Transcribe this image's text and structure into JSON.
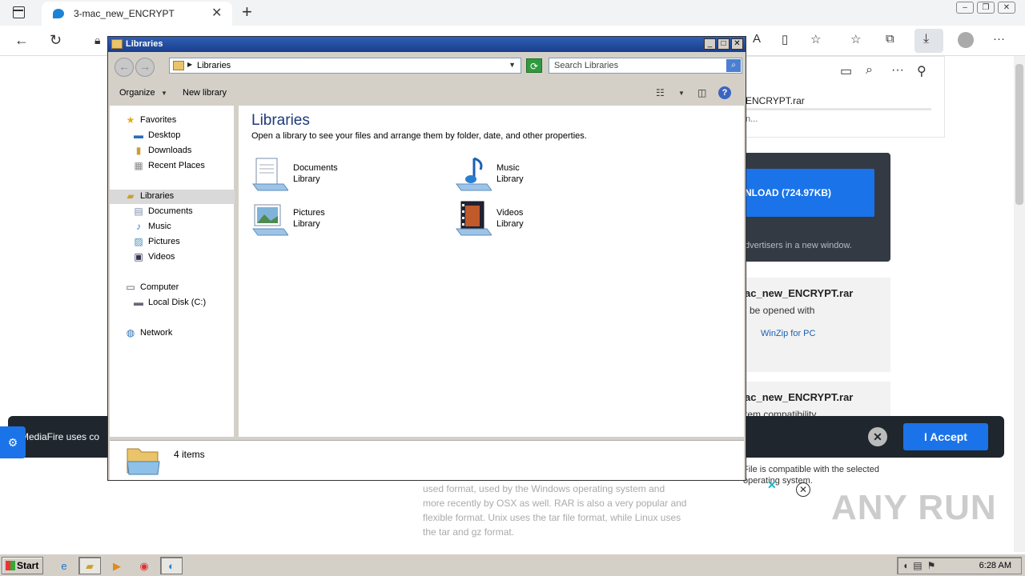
{
  "browser": {
    "tab_title": "3-mac_new_ENCRYPT",
    "download_panel": {
      "filename": "ENCRYPT.rar",
      "status": "n..."
    }
  },
  "webpage": {
    "download_button": "NLOAD (724.97KB)",
    "download_note": "dvertisers in a new window.",
    "info_card_1": {
      "title": "ac_new_ENCRYPT.rar",
      "subtitle": "be opened with",
      "link": "WinZip for PC"
    },
    "info_card_2": {
      "title": "ac_new_ENCRYPT.rar",
      "subtitle": "tem compatibility"
    },
    "compat_note": "File is compatible with the selected operating system.",
    "paragraph": "used format, used by the Windows operating system and more recently by OSX as well. RAR is also a very popular and flexible format. Unix uses the tar file format, while Linux uses the tar and gz format.",
    "cookie_text": "MediaFire uses co",
    "cookie_accept": "I Accept",
    "watermark": "ANY RUN"
  },
  "explorer": {
    "title": "Libraries",
    "address": "Libraries",
    "search_placeholder": "Search Libraries",
    "toolbar": {
      "organize": "Organize",
      "new_library": "New library"
    },
    "nav": {
      "favorites": "Favorites",
      "desktop": "Desktop",
      "downloads": "Downloads",
      "recent_places": "Recent Places",
      "libraries": "Libraries",
      "documents": "Documents",
      "music": "Music",
      "pictures": "Pictures",
      "videos": "Videos",
      "computer": "Computer",
      "local_disk": "Local Disk (C:)",
      "network": "Network"
    },
    "content": {
      "heading": "Libraries",
      "description": "Open a library to see your files and arrange them by folder, date, and other properties.",
      "items": [
        {
          "name": "Documents",
          "type": "Library"
        },
        {
          "name": "Music",
          "type": "Library"
        },
        {
          "name": "Pictures",
          "type": "Library"
        },
        {
          "name": "Videos",
          "type": "Library"
        }
      ]
    },
    "status": "4 items"
  },
  "taskbar": {
    "start": "Start",
    "clock": "6:28 AM"
  }
}
